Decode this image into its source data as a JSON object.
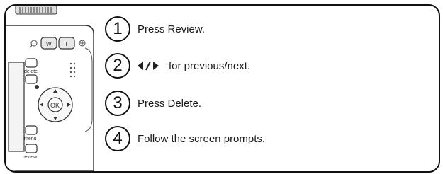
{
  "camera": {
    "icons": [
      "wide-zoom-icon",
      "telephoto-zoom-icon",
      "magnify-icon",
      "info-icon",
      "ok-button",
      "delete-button",
      "menu-button",
      "review-button"
    ],
    "labels": {
      "delete": "delete",
      "menu": "menu",
      "review": "review",
      "ok": "OK"
    }
  },
  "steps": [
    {
      "number": "1",
      "text": "Press Review."
    },
    {
      "number": "2",
      "text": "for previous/next."
    },
    {
      "number": "3",
      "text": "Press Delete."
    },
    {
      "number": "4",
      "text": "Follow the screen prompts."
    }
  ]
}
